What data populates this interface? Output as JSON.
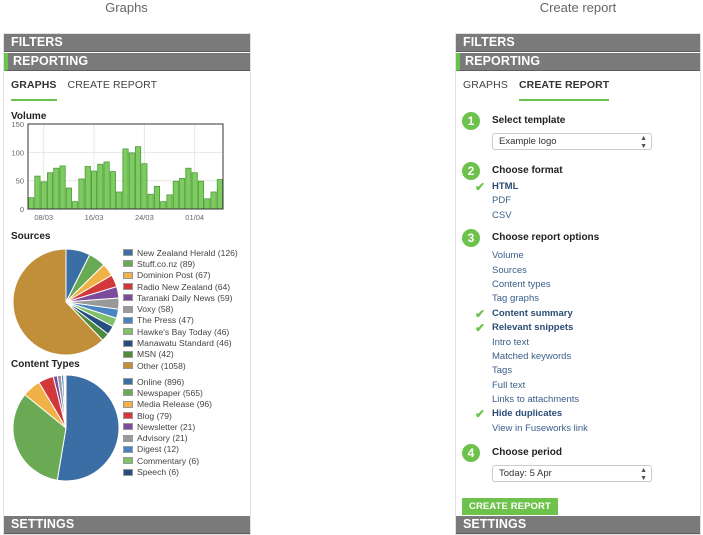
{
  "captions": {
    "left": "Graphs",
    "right": "Create report"
  },
  "left_panel": {
    "sections": {
      "filters": "FILTERS",
      "reporting": "REPORTING",
      "settings": "SETTINGS"
    },
    "tabs": [
      {
        "label": "GRAPHS",
        "selected": true
      },
      {
        "label": "CREATE REPORT",
        "selected": false
      }
    ],
    "volume_title": "Volume",
    "sources_title": "Sources",
    "content_types_title": "Content Types"
  },
  "right_panel": {
    "sections": {
      "filters": "FILTERS",
      "reporting": "REPORTING",
      "settings": "SETTINGS"
    },
    "tabs": [
      {
        "label": "GRAPHS",
        "selected": false
      },
      {
        "label": "CREATE REPORT",
        "selected": true
      }
    ],
    "steps": [
      {
        "num": "1",
        "title": "Select template",
        "select_value": "Example logo"
      },
      {
        "num": "2",
        "title": "Choose format",
        "options": [
          {
            "label": "HTML",
            "checked": true
          },
          {
            "label": "PDF",
            "checked": false
          },
          {
            "label": "CSV",
            "checked": false
          }
        ]
      },
      {
        "num": "3",
        "title": "Choose report options",
        "options": [
          {
            "label": "Volume",
            "checked": false
          },
          {
            "label": "Sources",
            "checked": false
          },
          {
            "label": "Content types",
            "checked": false
          },
          {
            "label": "Tag graphs",
            "checked": false
          },
          {
            "label": "Content summary",
            "checked": true
          },
          {
            "label": "Relevant snippets",
            "checked": true
          },
          {
            "label": "Intro text",
            "checked": false
          },
          {
            "label": "Matched keywords",
            "checked": false
          },
          {
            "label": "Tags",
            "checked": false
          },
          {
            "label": "Full text",
            "checked": false
          },
          {
            "label": "Links to attachments",
            "checked": false
          },
          {
            "label": "Hide duplicates",
            "checked": true
          },
          {
            "label": "View in Fuseworks link",
            "checked": false
          }
        ]
      },
      {
        "num": "4",
        "title": "Choose period",
        "select_value": "Today: 5 Apr"
      }
    ],
    "create_button": "CREATE REPORT"
  },
  "colors": {
    "accent": "#6cc24a",
    "section_bar": "#7a7a7a",
    "link": "#3a5f8a"
  },
  "chart_data": [
    {
      "type": "bar",
      "title": "Volume",
      "ylim": [
        0,
        150
      ],
      "yticks": [
        0,
        50,
        100,
        150
      ],
      "xtick_labels": [
        "08/03",
        "16/03",
        "24/03",
        "01/04"
      ],
      "xtick_positions": [
        2,
        10,
        18,
        26
      ],
      "values": [
        20,
        58,
        48,
        64,
        72,
        76,
        37,
        13,
        53,
        75,
        67,
        79,
        83,
        66,
        30,
        106,
        99,
        110,
        80,
        26,
        40,
        13,
        25,
        49,
        54,
        72,
        64,
        49,
        18,
        30,
        52
      ],
      "grid": true,
      "color": "#7dcc5f"
    },
    {
      "type": "pie",
      "title": "Sources",
      "legend": "right",
      "slices": [
        {
          "label": "New Zealand Herald",
          "value": 126,
          "color": "#3a6ea5"
        },
        {
          "label": "Stuff.co.nz",
          "value": 89,
          "color": "#6aaa55"
        },
        {
          "label": "Dominion Post",
          "value": 67,
          "color": "#f0b247"
        },
        {
          "label": "Radio New Zealand",
          "value": 64,
          "color": "#d2383a"
        },
        {
          "label": "Taranaki Daily News",
          "value": 59,
          "color": "#7d4b9e"
        },
        {
          "label": "Voxy",
          "value": 58,
          "color": "#999999"
        },
        {
          "label": "The Press",
          "value": 47,
          "color": "#4a84c0"
        },
        {
          "label": "Hawke's Bay Today",
          "value": 46,
          "color": "#7fc06b"
        },
        {
          "label": "Manawatu Standard",
          "value": 46,
          "color": "#274e7e"
        },
        {
          "label": "MSN",
          "value": 42,
          "color": "#4e8a3c"
        },
        {
          "label": "Other",
          "value": 1058,
          "color": "#c18e39"
        }
      ]
    },
    {
      "type": "pie",
      "title": "Content Types",
      "legend": "right",
      "slices": [
        {
          "label": "Online",
          "value": 896,
          "color": "#3a6ea5"
        },
        {
          "label": "Newspaper",
          "value": 565,
          "color": "#6aaa55"
        },
        {
          "label": "Media Release",
          "value": 96,
          "color": "#f0b247"
        },
        {
          "label": "Blog",
          "value": 79,
          "color": "#d2383a"
        },
        {
          "label": "Newsletter",
          "value": 21,
          "color": "#7d4b9e"
        },
        {
          "label": "Advisory",
          "value": 21,
          "color": "#999999"
        },
        {
          "label": "Digest",
          "value": 12,
          "color": "#4a84c0"
        },
        {
          "label": "Commentary",
          "value": 6,
          "color": "#7fc06b"
        },
        {
          "label": "Speech",
          "value": 6,
          "color": "#274e7e"
        }
      ]
    }
  ]
}
